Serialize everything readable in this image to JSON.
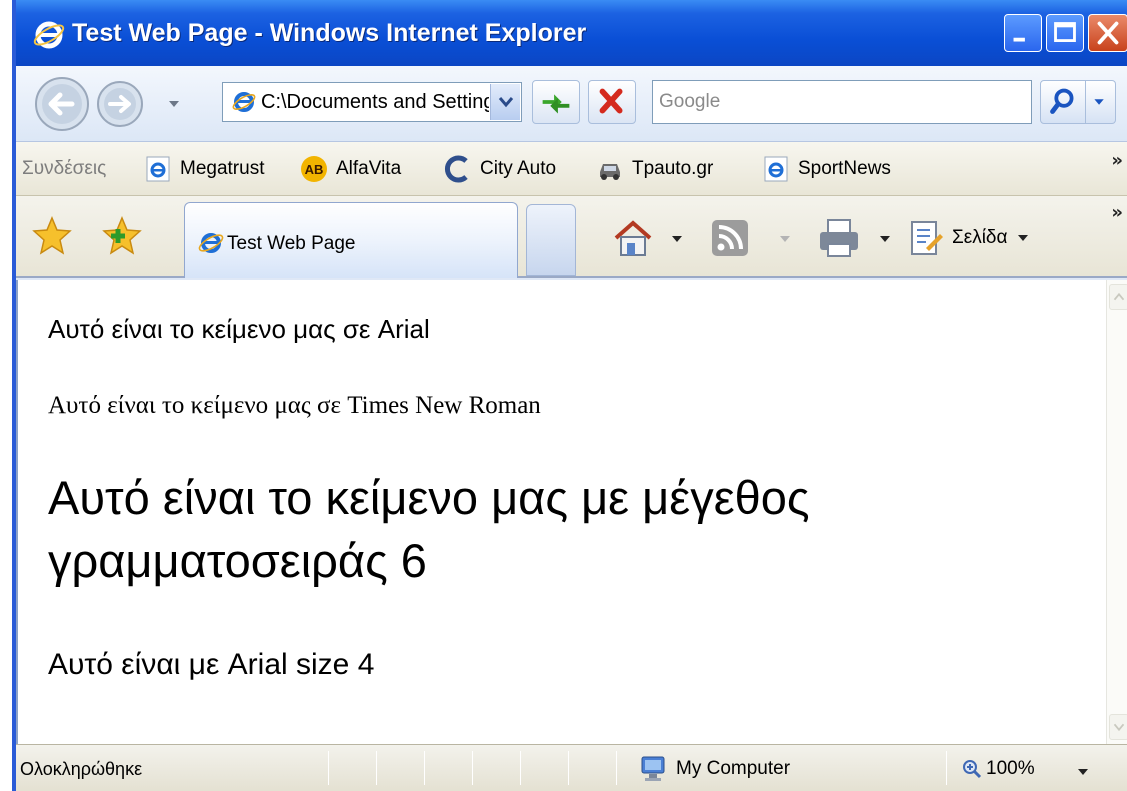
{
  "window": {
    "title": "Test Web Page - Windows Internet Explorer"
  },
  "address_bar": {
    "url": "C:\\Documents and Settings"
  },
  "search": {
    "placeholder": "Google"
  },
  "links_bar": {
    "label": "Συνδέσεις",
    "links": [
      {
        "label": "Megatrust",
        "icon": "ie-page-icon"
      },
      {
        "label": "AlfaVita",
        "icon": "ab-logo-icon"
      },
      {
        "label": "City Auto",
        "icon": "c-logo-icon"
      },
      {
        "label": "Tpauto.gr",
        "icon": "car-icon"
      },
      {
        "label": "SportNews",
        "icon": "ie-page-icon"
      }
    ],
    "overflow": "»"
  },
  "tabs": {
    "active": "Test Web Page"
  },
  "command_bar": {
    "page_menu": "Σελίδα",
    "overflow": "»"
  },
  "content": {
    "arial": "Αυτό είναι το κείμενο μας σε Arial",
    "times": "Αυτό είναι το κείμενο μας σε Times New Roman",
    "big": "Αυτό είναι το κείμενο μας με μέγεθος γραμματοσειράς 6",
    "size4": "Αυτό είναι με Arial size 4"
  },
  "status_bar": {
    "status": "Ολοκληρώθηκε",
    "zone": "My Computer",
    "zoom": "100%"
  },
  "colors": {
    "titlebar": "#0a4fd6",
    "close_button": "#c8421c",
    "ie_logo": "#1f6fd6"
  }
}
